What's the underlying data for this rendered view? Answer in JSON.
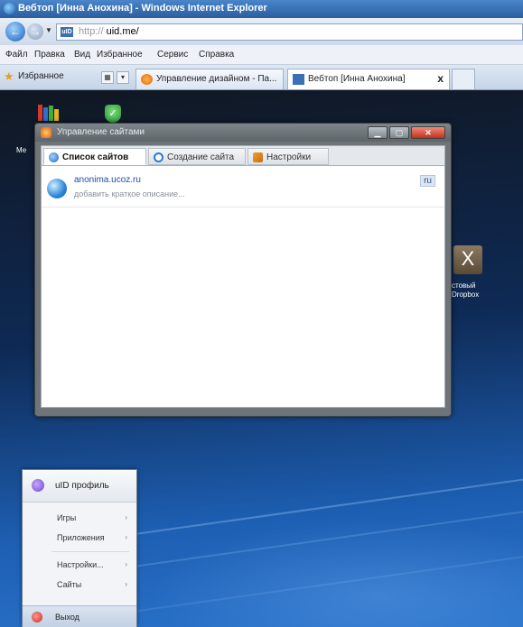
{
  "browser": {
    "title": "Вебтоп [Инна Анохина] - Windows Internet Explorer",
    "address_prefix": "http://",
    "address_masked": "    ",
    "address_host": "uid.me/",
    "menu": [
      "Файл",
      "Правка",
      "Вид",
      "Избранное",
      "Сервис",
      "Справка"
    ],
    "favorites_label": "Избранное",
    "tabs": [
      {
        "label": "Управление дизайном - Па..."
      },
      {
        "label": "Вебтоп [Инна Анохина]"
      }
    ],
    "tab_close": "x"
  },
  "desktop": {
    "left_label": "Ме",
    "right_icon_glyph": "X",
    "right_label_line1": "стовый",
    "right_label_line2": "Dropbox"
  },
  "window": {
    "title": "Управление сайтами",
    "tabs": [
      "Список сайтов",
      "Создание сайта",
      "Настройки"
    ],
    "sites": [
      {
        "name": "anonima.ucoz.ru",
        "description": "добавить краткое описание...",
        "lang": "ru"
      }
    ]
  },
  "start_menu": {
    "profile": "uID профиль",
    "items": [
      "Игры",
      "Приложения",
      "Настройки...",
      "Сайты"
    ],
    "arrow": "›",
    "exit": "Выход"
  }
}
